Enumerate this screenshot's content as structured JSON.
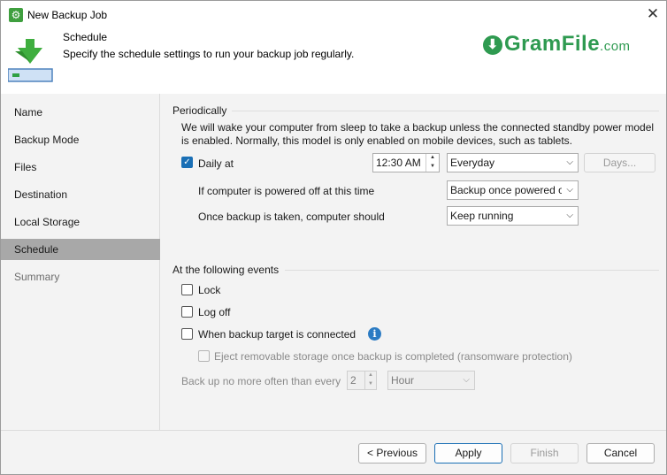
{
  "window": {
    "title": "New Backup Job",
    "close_glyph": "✕"
  },
  "header": {
    "title": "Schedule",
    "subtitle": "Specify the schedule settings to run your backup job regularly.",
    "logo_main": "GramFile",
    "logo_suffix": ".com"
  },
  "sidebar": {
    "items": [
      {
        "label": "Name"
      },
      {
        "label": "Backup Mode"
      },
      {
        "label": "Files"
      },
      {
        "label": "Destination"
      },
      {
        "label": "Local Storage"
      },
      {
        "label": "Schedule"
      },
      {
        "label": "Summary"
      }
    ]
  },
  "periodically": {
    "heading": "Periodically",
    "note": "We will wake your computer from sleep to take a backup unless the connected standby power model is enabled. Normally, this model is only enabled on mobile devices, such as tablets.",
    "daily_label": "Daily at",
    "daily_checked": true,
    "time_value": "12:30 AM",
    "frequency_value": "Everyday",
    "days_button": "Days...",
    "powered_off_label": "If computer is powered off at this time",
    "powered_off_value": "Backup once powered on",
    "after_backup_label": "Once backup is taken, computer should",
    "after_backup_value": "Keep running"
  },
  "events": {
    "heading": "At the following events",
    "lock_label": "Lock",
    "logoff_label": "Log off",
    "target_label": "When backup target is connected",
    "eject_label": "Eject removable storage once backup is completed (ransomware protection)",
    "limit_label": "Back up no more often than every",
    "limit_value": "2",
    "limit_unit": "Hour"
  },
  "footer": {
    "previous": "< Previous",
    "apply": "Apply",
    "finish": "Finish",
    "cancel": "Cancel"
  },
  "colors": {
    "accent": "#1a6fb5",
    "brand": "#2e9a50",
    "selected_nav": "#a8a8a8"
  }
}
